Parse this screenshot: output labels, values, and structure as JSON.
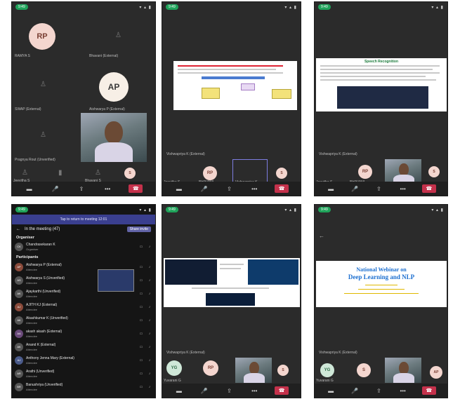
{
  "status": {
    "pill": "9:49",
    "time": "9:49 ...",
    "icons": "▾ ▴ ▮"
  },
  "toolbar": {
    "camera": "▬",
    "mic": "🎤",
    "share": "⇪",
    "more": "•••",
    "end": "☎"
  },
  "p1": {
    "rp_initials": "RP",
    "ap_initials": "AP",
    "label1": "RAMYA S",
    "label2": "Bhavani (External)",
    "label3": "SWAP (External)",
    "label4": "Aishwarya P (External)",
    "label5": "Pragnya Rout (Unverified)",
    "bottom1": "Jeevitha S",
    "bottom2": "Bhavani S"
  },
  "p2": {
    "presenter": "Vishwapriya K (External)",
    "bottom1": "Jeevitha S",
    "bottom2": "BHAVANI",
    "bottom3": "Vishwapriya K",
    "rp_initials": "RP",
    "s_initials": "S"
  },
  "p3": {
    "presenter": "Vishwapriya K (External)",
    "slide_title": "Speech Recognition",
    "bottom1": "Jeevitha S",
    "bottom2": "BHAVANI",
    "rp_initials": "RP",
    "s_initials": "S"
  },
  "p4": {
    "banner": "Tap to return to meeting 12:01",
    "title": "In the meeting (47)",
    "share_btn": "Share invite",
    "organiser_heading": "Organiser",
    "participants_heading": "Participants",
    "organiser": {
      "name": "Chandrasekaran K",
      "role": "Organiser"
    },
    "participants": [
      {
        "initials": "AP",
        "name": "Aishwarya P (External)",
        "role": "Attendee"
      },
      {
        "initials": "AS",
        "name": "Aishwarya S (Unverified)",
        "role": "Attendee"
      },
      {
        "initials": "AK",
        "name": "Ajaykarthi (Unverified)",
        "role": "Attendee"
      },
      {
        "initials": "AJ",
        "name": "AJITH KJ (External)",
        "role": "Attendee"
      },
      {
        "initials": "AK",
        "name": "Akashkumar K (Unverified)",
        "role": "Attendee"
      },
      {
        "initials": "AA",
        "name": "akash akash (External)",
        "role": "Attendee"
      },
      {
        "initials": "AK",
        "name": "Anand K (External)",
        "role": "Attendee"
      },
      {
        "initials": "AJ",
        "name": "Anthony Jenna Mary (External)",
        "role": "Attendee"
      },
      {
        "initials": "AR",
        "name": "Arathi (Unverified)",
        "role": "Attendee"
      },
      {
        "initials": "BR",
        "name": "Banushriya (Unverified)",
        "role": "Attendee"
      }
    ]
  },
  "p5": {
    "presenter": "Vishwapriya K (External)",
    "yg_initials": "YG",
    "rp_initials": "RP",
    "s_initials": "S",
    "bottom1": "Yuvarani G"
  },
  "p6": {
    "title_line1": "National Webinar on",
    "title_line2": "Deep Learning and NLP",
    "presenter": "Vishwapriya K (External)",
    "yg_initials": "YG",
    "s_initials": "S",
    "ap_initials": "AP",
    "bottom1": "Yuvarani G"
  }
}
